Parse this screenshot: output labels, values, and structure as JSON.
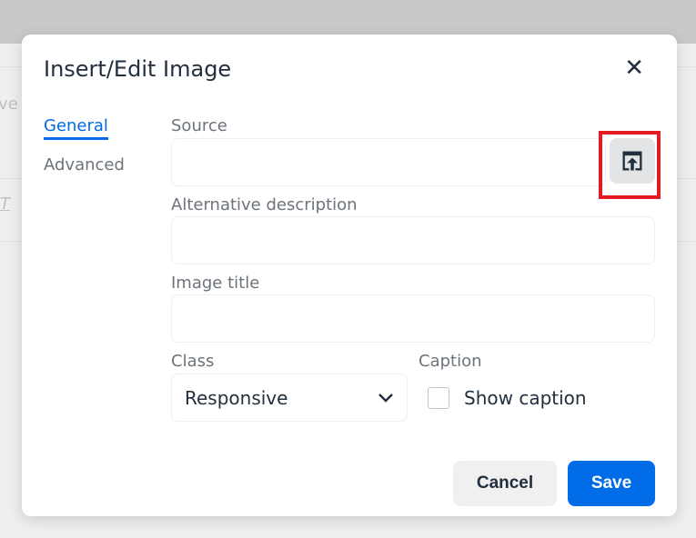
{
  "dialog": {
    "title": "Insert/Edit Image",
    "close_icon": "close-icon"
  },
  "tabs": [
    {
      "label": "General",
      "active": true
    },
    {
      "label": "Advanced",
      "active": false
    }
  ],
  "fields": {
    "source": {
      "label": "Source",
      "value": ""
    },
    "alt": {
      "label": "Alternative description",
      "value": ""
    },
    "title": {
      "label": "Image title",
      "value": ""
    },
    "class": {
      "label": "Class",
      "selected": "Responsive"
    },
    "caption": {
      "label": "Caption",
      "checkbox_label": "Show caption",
      "checked": false
    }
  },
  "buttons": {
    "cancel": "Cancel",
    "save": "Save"
  },
  "background": {
    "partial_text": "ve"
  },
  "colors": {
    "accent": "#006ce7",
    "highlight": "#e51b23"
  }
}
